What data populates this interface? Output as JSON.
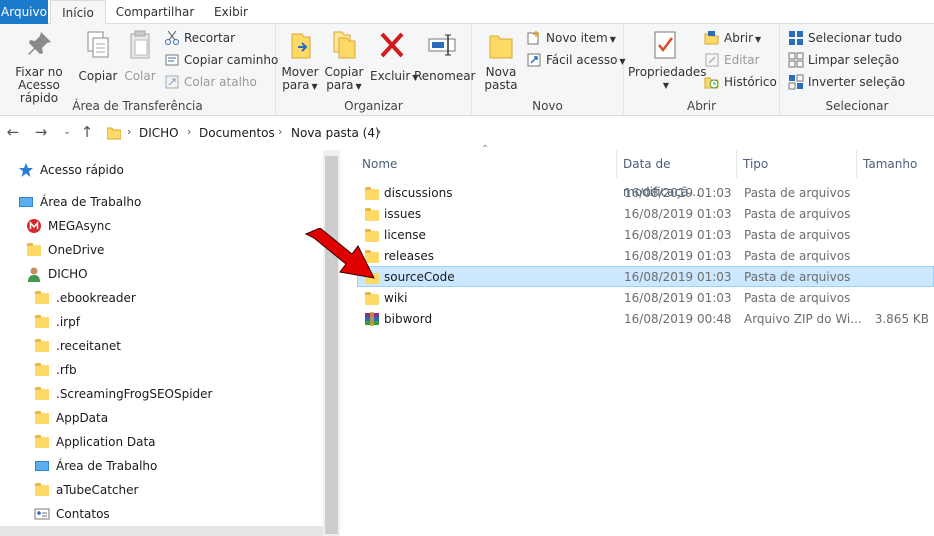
{
  "ribbon_tabs": [
    "Arquivo",
    "Início",
    "Compartilhar",
    "Exibir"
  ],
  "clipboard": {
    "pin_label_1": "Fixar no",
    "pin_label_2": "Acesso rápido",
    "copy_label": "Copiar",
    "paste_label": "Colar",
    "cut_label": "Recortar",
    "copy_path_label": "Copiar caminho",
    "paste_shortcut_label": "Colar atalho",
    "group_label": "Área de Transferência"
  },
  "organize": {
    "move_label_1": "Mover",
    "move_label_2": "para",
    "copyto_label_1": "Copiar",
    "copyto_label_2": "para",
    "delete_label": "Excluir",
    "rename_label": "Renomear",
    "group_label": "Organizar"
  },
  "new": {
    "new_folder_label_1": "Nova",
    "new_folder_label_2": "pasta",
    "new_item_label": "Novo item",
    "easy_access_label": "Fácil acesso",
    "group_label": "Novo"
  },
  "open": {
    "properties_label": "Propriedades",
    "open_label": "Abrir",
    "edit_label": "Editar",
    "history_label": "Histórico",
    "group_label": "Abrir"
  },
  "select": {
    "select_all_label": "Selecionar tudo",
    "select_none_label": "Limpar seleção",
    "invert_label": "Inverter seleção",
    "group_label": "Selecionar"
  },
  "address": {
    "crumbs": [
      "DICHO",
      "Documentos",
      "Nova pasta (4)"
    ]
  },
  "nav_pane": [
    {
      "label": "Acesso rápido",
      "icon": "star-icon"
    },
    {
      "label": "Área de Trabalho",
      "icon": "desktop-icon"
    },
    {
      "label": "MEGAsync",
      "icon": "mega-icon"
    },
    {
      "label": "OneDrive",
      "icon": "folder-icon"
    },
    {
      "label": "DICHO",
      "icon": "user-icon"
    },
    {
      "label": ".ebookreader",
      "icon": "folder-icon"
    },
    {
      "label": ".irpf",
      "icon": "folder-icon"
    },
    {
      "label": ".receitanet",
      "icon": "folder-icon"
    },
    {
      "label": ".rfb",
      "icon": "folder-icon"
    },
    {
      "label": ".ScreamingFrogSEOSpider",
      "icon": "folder-icon"
    },
    {
      "label": "AppData",
      "icon": "folder-icon"
    },
    {
      "label": "Application Data",
      "icon": "folder-icon"
    },
    {
      "label": "Área de Trabalho",
      "icon": "desktop-icon"
    },
    {
      "label": "aTubeCatcher",
      "icon": "folder-icon"
    },
    {
      "label": "Contatos",
      "icon": "contacts-icon"
    }
  ],
  "columns": {
    "name": "Nome",
    "date": "Data de modificaçã...",
    "type": "Tipo",
    "size": "Tamanho"
  },
  "files": [
    {
      "name": "discussions",
      "date": "16/08/2019 01:03",
      "type": "Pasta de arquivos",
      "size": "",
      "icon": "folder-icon"
    },
    {
      "name": "issues",
      "date": "16/08/2019 01:03",
      "type": "Pasta de arquivos",
      "size": "",
      "icon": "folder-icon"
    },
    {
      "name": "license",
      "date": "16/08/2019 01:03",
      "type": "Pasta de arquivos",
      "size": "",
      "icon": "folder-icon"
    },
    {
      "name": "releases",
      "date": "16/08/2019 01:03",
      "type": "Pasta de arquivos",
      "size": "",
      "icon": "folder-icon"
    },
    {
      "name": "sourceCode",
      "date": "16/08/2019 01:03",
      "type": "Pasta de arquivos",
      "size": "",
      "icon": "folder-icon",
      "selected": true
    },
    {
      "name": "wiki",
      "date": "16/08/2019 01:03",
      "type": "Pasta de arquivos",
      "size": "",
      "icon": "folder-icon"
    },
    {
      "name": "bibword",
      "date": "16/08/2019 00:48",
      "type": "Arquivo ZIP do Wi...",
      "size": "3.865 KB",
      "icon": "zip-icon"
    }
  ],
  "colors": {
    "accent": "#1979ca",
    "selection": "#cce8ff",
    "arrow": "#e00000"
  }
}
